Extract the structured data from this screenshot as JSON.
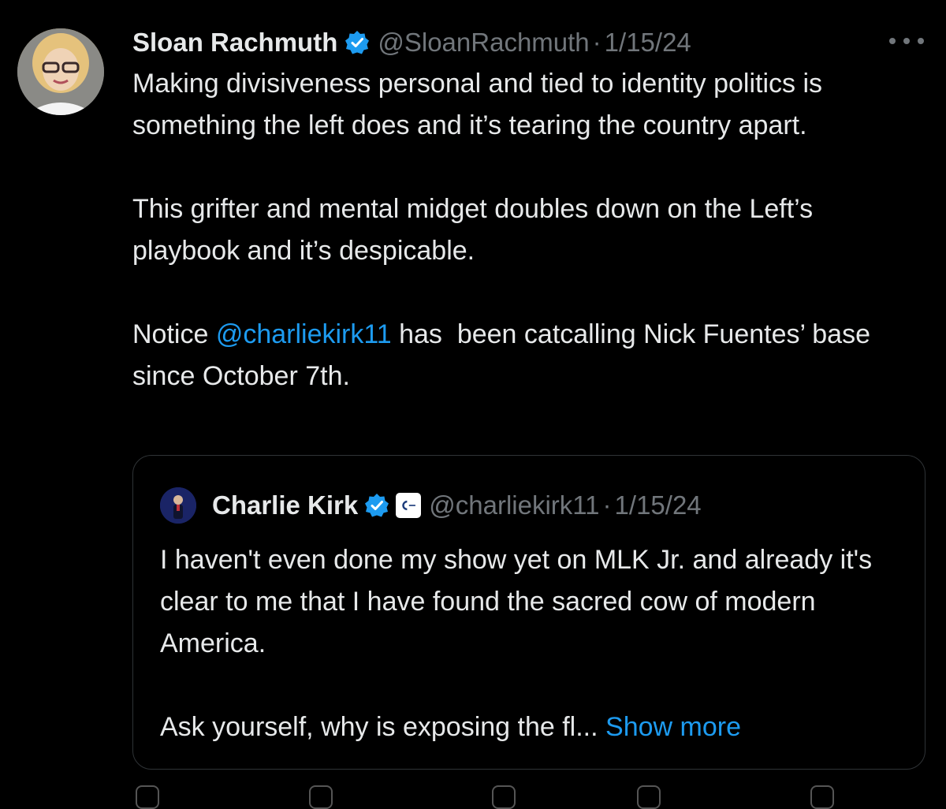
{
  "tweet": {
    "author_name": "Sloan Rachmuth",
    "handle": "@SloanRachmuth",
    "separator": "·",
    "date": "1/15/24",
    "paragraphs": [
      "Making divisiveness personal and tied to identity politics is something the left does and it’s tearing the country apart.",
      "This grifter and mental midget doubles down on the Left’s playbook and it’s despicable."
    ],
    "notice_prefix": "Notice ",
    "mention": "@charliekirk11",
    "notice_suffix": " has  been catcalling Nick Fuentes’ base since October 7th."
  },
  "quote": {
    "author_name": "Charlie Kirk",
    "handle": "@charliekirk11",
    "separator": "·",
    "date": "1/15/24",
    "paragraph_1": "I haven't even done my show yet on MLK Jr. and already it's clear to me that I have found the sacred cow of modern America.",
    "truncated_text": "Ask yourself, why is exposing the fl... ",
    "show_more": "Show more"
  },
  "colors": {
    "background": "#000000",
    "text": "#e7e9ea",
    "secondary": "#71767b",
    "link": "#1d9bf0",
    "border": "#2f3336"
  },
  "icons": {
    "verified": "verified-badge-icon",
    "more": "more-options-icon",
    "affiliation": "organization-badge-icon"
  }
}
